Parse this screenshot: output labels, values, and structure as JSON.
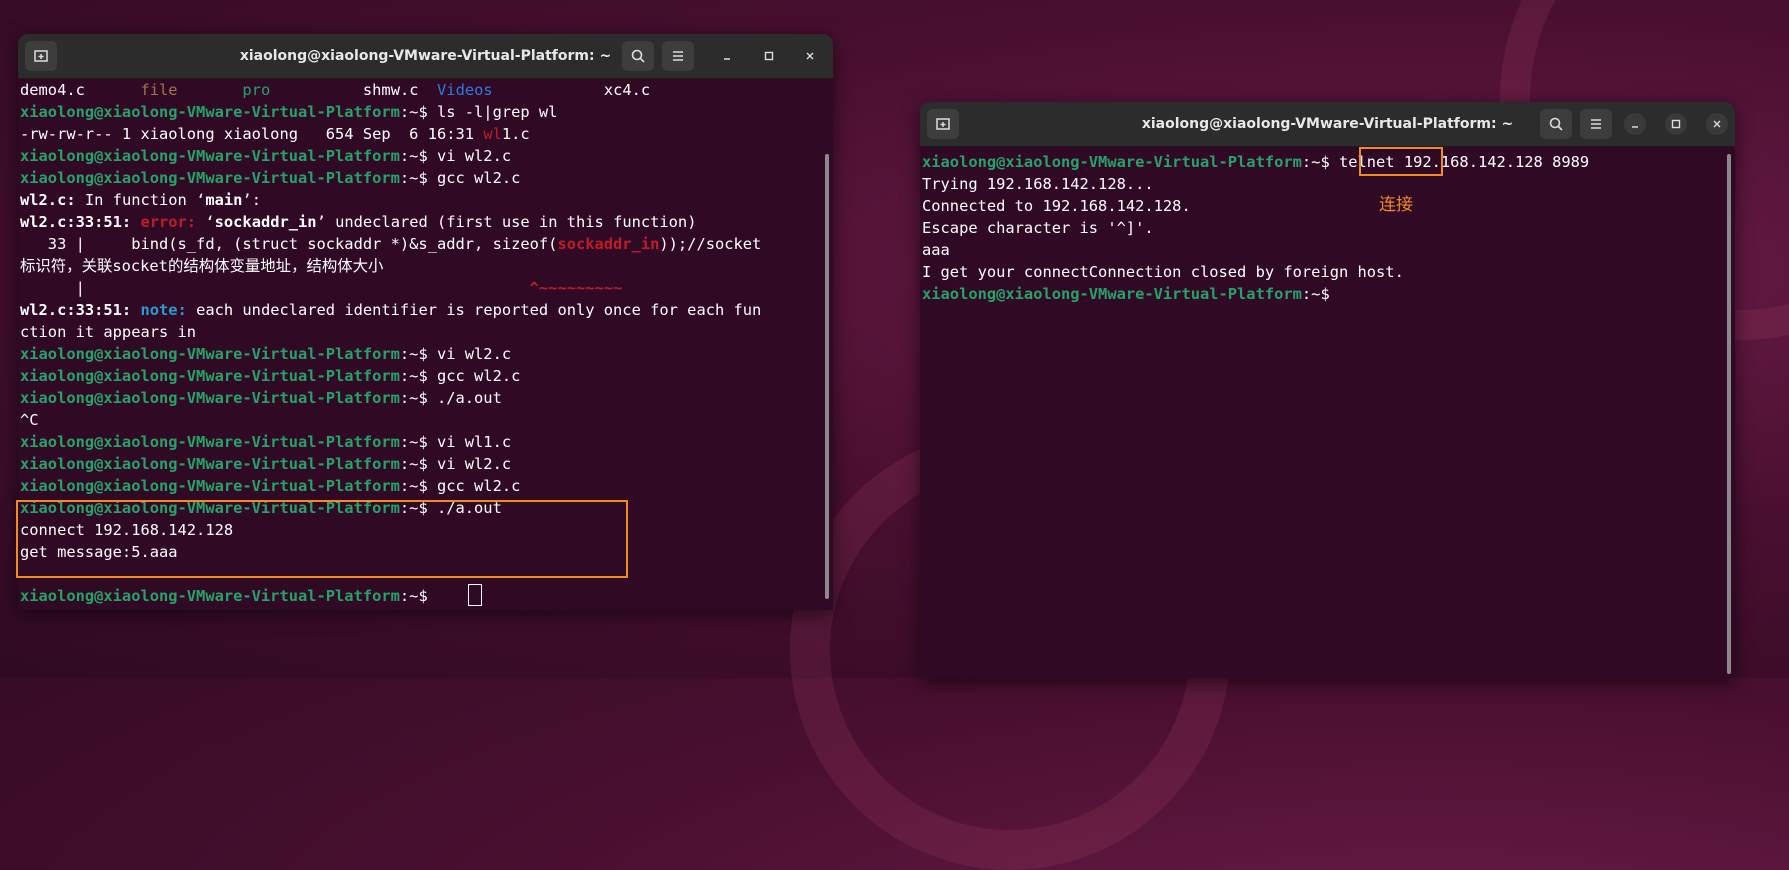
{
  "left_window": {
    "title": "xiaolong@xiaolong-VMware-Virtual-Platform: ~",
    "lines": [
      [
        {
          "t": "demo4.c      ",
          "c": "w"
        },
        {
          "t": "file",
          "c": "yl"
        },
        {
          "t": "       ",
          "c": "w"
        },
        {
          "t": "pro",
          "c": "gr"
        },
        {
          "t": "          shmw.c  ",
          "c": "w"
        },
        {
          "t": "Videos",
          "c": "dir"
        },
        {
          "t": "            xc4.c",
          "c": "w"
        }
      ],
      [
        {
          "t": "xiaolong@xiaolong-VMware-Virtual-Platform",
          "c": "p"
        },
        {
          "t": ":~$ ls -l|grep wl",
          "c": "w"
        }
      ],
      [
        {
          "t": "-rw-rw-r-- 1 xiaolong xiaolong   654 Sep  6 16:31 ",
          "c": "w"
        },
        {
          "t": "wl",
          "c": "red"
        },
        {
          "t": "1.c",
          "c": "w"
        }
      ],
      [
        {
          "t": "xiaolong@xiaolong-VMware-Virtual-Platform",
          "c": "p"
        },
        {
          "t": ":~$ vi wl2.c",
          "c": "w"
        }
      ],
      [
        {
          "t": "xiaolong@xiaolong-VMware-Virtual-Platform",
          "c": "p"
        },
        {
          "t": ":~$ gcc wl2.c",
          "c": "w"
        }
      ],
      [
        {
          "t": "wl2.c:",
          "c": "b"
        },
        {
          "t": " In function ‘",
          "c": "w"
        },
        {
          "t": "main",
          "c": "b"
        },
        {
          "t": "’:",
          "c": "w"
        }
      ],
      [
        {
          "t": "wl2.c:33:51: ",
          "c": "b"
        },
        {
          "t": "error: ",
          "c": "r"
        },
        {
          "t": "‘",
          "c": "w"
        },
        {
          "t": "sockaddr_in",
          "c": "b"
        },
        {
          "t": "’ undeclared (first use in this function)",
          "c": "w"
        }
      ],
      [
        {
          "t": "   33 |     bind(s_fd, (struct sockaddr *)&s_addr, sizeof(",
          "c": "w"
        },
        {
          "t": "sockaddr_in",
          "c": "r"
        },
        {
          "t": "));//socket",
          "c": "w"
        }
      ],
      [
        {
          "t": "标识符，关联socket的结构体变量地址，结构体大小",
          "c": "w"
        }
      ],
      [
        {
          "t": "      |                                                ",
          "c": "w"
        },
        {
          "t": "^~~~~~~~~~",
          "c": "r"
        }
      ],
      [
        {
          "t": "wl2.c:33:51: ",
          "c": "b"
        },
        {
          "t": "note: ",
          "c": "note"
        },
        {
          "t": "each undeclared identifier is reported only once for each fun",
          "c": "w"
        }
      ],
      [
        {
          "t": "ction it appears in",
          "c": "w"
        }
      ],
      [
        {
          "t": "xiaolong@xiaolong-VMware-Virtual-Platform",
          "c": "p"
        },
        {
          "t": ":~$ vi wl2.c",
          "c": "w"
        }
      ],
      [
        {
          "t": "xiaolong@xiaolong-VMware-Virtual-Platform",
          "c": "p"
        },
        {
          "t": ":~$ gcc wl2.c",
          "c": "w"
        }
      ],
      [
        {
          "t": "xiaolong@xiaolong-VMware-Virtual-Platform",
          "c": "p"
        },
        {
          "t": ":~$ ./a.out",
          "c": "w"
        }
      ],
      [
        {
          "t": "^C",
          "c": "w"
        }
      ],
      [
        {
          "t": "xiaolong@xiaolong-VMware-Virtual-Platform",
          "c": "p"
        },
        {
          "t": ":~$ vi wl1.c",
          "c": "w"
        }
      ],
      [
        {
          "t": "xiaolong@xiaolong-VMware-Virtual-Platform",
          "c": "p"
        },
        {
          "t": ":~$ vi wl2.c",
          "c": "w"
        }
      ],
      [
        {
          "t": "xiaolong@xiaolong-VMware-Virtual-Platform",
          "c": "p"
        },
        {
          "t": ":~$ gcc wl2.c",
          "c": "w"
        }
      ],
      [
        {
          "t": "xiaolong@xiaolong-VMware-Virtual-Platform",
          "c": "p"
        },
        {
          "t": ":~$ ./a.out",
          "c": "w"
        }
      ],
      [
        {
          "t": "connect 192.168.142.128",
          "c": "w"
        }
      ],
      [
        {
          "t": "get message:5.aaa",
          "c": "w"
        }
      ],
      [
        {
          "t": "",
          "c": "w"
        }
      ],
      [
        {
          "t": "xiaolong@xiaolong-VMware-Virtual-Platform",
          "c": "p"
        },
        {
          "t": ":~$ ",
          "c": "w"
        }
      ]
    ]
  },
  "right_window": {
    "title": "xiaolong@xiaolong-VMware-Virtual-Platform: ~",
    "lines": [
      [
        {
          "t": "xiaolong@xiaolong-VMware-Virtual-Platform",
          "c": "p"
        },
        {
          "t": ":~$ telnet 192.168.142.128 8989",
          "c": "w"
        }
      ],
      [
        {
          "t": "Trying 192.168.142.128...",
          "c": "w"
        }
      ],
      [
        {
          "t": "Connected to 192.168.142.128.",
          "c": "w"
        }
      ],
      [
        {
          "t": "Escape character is '^]'.",
          "c": "w"
        }
      ],
      [
        {
          "t": "aaa",
          "c": "w"
        }
      ],
      [
        {
          "t": "I get your connectConnection closed by foreign host.",
          "c": "w"
        }
      ],
      [
        {
          "t": "xiaolong@xiaolong-VMware-Virtual-Platform",
          "c": "p"
        },
        {
          "t": ":~$",
          "c": "w"
        }
      ]
    ],
    "annotation": "连接"
  },
  "colors": {
    "accent_box": "#f08a24",
    "prompt": "#26a269",
    "bg": "#300a24"
  },
  "icons": {
    "new_tab": "new-tab-icon",
    "search": "search-icon",
    "menu": "hamburger-menu-icon",
    "minimize": "minimize-icon",
    "maximize": "maximize-icon",
    "close": "close-icon"
  }
}
